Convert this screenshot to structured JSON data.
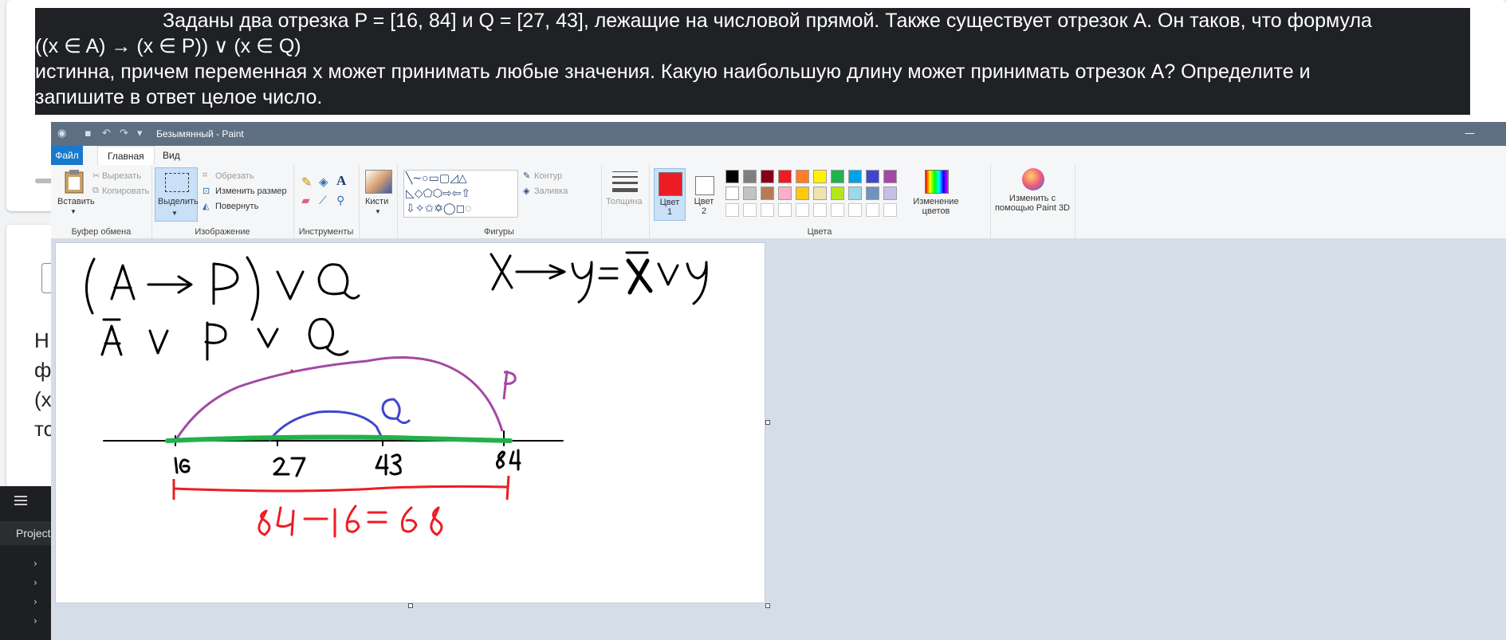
{
  "task": {
    "lines": [
      "Заданы два отрезка P = [16, 84] и Q = [27, 43], лежащие на числовой прямой. Также существует отрезок A. Он таков, что формула",
      "((x ∈ A) → (x ∈ P)) ∨ (x ∈ Q)",
      "истинна, причем переменная x может принимать любые значения. Какую наибольшую длину может принимать отрезок А? Определите и",
      "запишите в ответ целое число."
    ]
  },
  "background_fragments": {
    "left_chars": [
      "Н",
      "ф",
      "(х",
      "то"
    ],
    "editor_label": "Project"
  },
  "paint": {
    "title": "Безымянный - Paint",
    "tabs": {
      "file": "Файл",
      "home": "Главная",
      "view": "Вид"
    },
    "clipboard": {
      "paste": "Вставить",
      "cut": "Вырезать",
      "copy": "Копировать",
      "label": "Буфер обмена"
    },
    "image": {
      "select": "Выделить",
      "crop": "Обрезать",
      "resize": "Изменить размер",
      "rotate": "Повернуть",
      "label": "Изображение"
    },
    "tools": {
      "label": "Инструменты"
    },
    "brushes": {
      "label": "Кисти"
    },
    "shapes": {
      "outline": "Контур",
      "fill": "Заливка",
      "label": "Фигуры"
    },
    "thickness": {
      "label": "Толщина"
    },
    "colors": {
      "color1": "Цвет 1",
      "color2": "Цвет 2",
      "edit": "Изменение цветов",
      "label": "Цвета",
      "color1_value": "#ed1c24",
      "color2_value": "#ffffff",
      "palette_row1": [
        "#000000",
        "#7f7f7f",
        "#880015",
        "#ed1c24",
        "#ff7f27",
        "#fff200",
        "#22b14c",
        "#00a2e8",
        "#3f48cc",
        "#a349a4"
      ],
      "palette_row2": [
        "#ffffff",
        "#c3c3c3",
        "#b97a57",
        "#ffaec9",
        "#ffc90e",
        "#efe4b0",
        "#b5e61d",
        "#99d9ea",
        "#7092be",
        "#c8bfe7"
      ]
    },
    "paint3d": {
      "label": "Изменить с помощью Paint 3D"
    }
  },
  "drawing": {
    "formula1": "(A → P) V Q",
    "formula2": "Ā V P V Q",
    "formula3": "X → y = X̄ V y",
    "label_p": "P",
    "label_q": "Q",
    "ticks": [
      "16",
      "27",
      "43",
      "84"
    ],
    "answer": "84−16 = 68"
  }
}
